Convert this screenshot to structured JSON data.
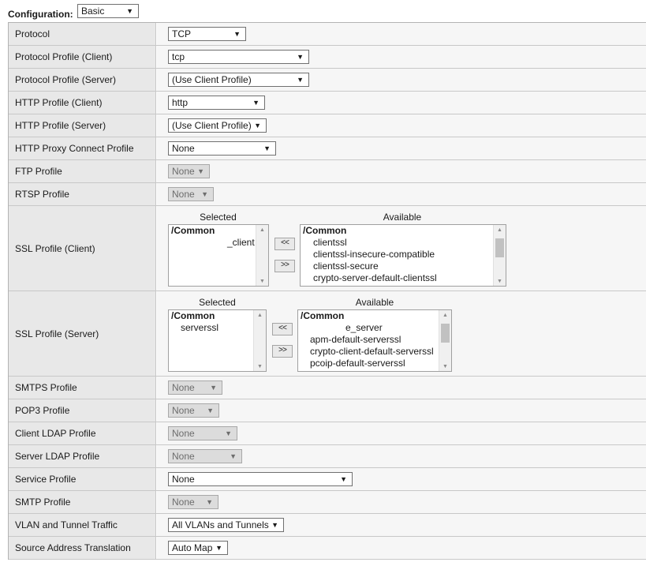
{
  "configuration": {
    "label": "Configuration:",
    "value": "Basic"
  },
  "rows": {
    "protocol": {
      "label": "Protocol",
      "value": "TCP"
    },
    "protocol_profile_client": {
      "label": "Protocol Profile (Client)",
      "value": "tcp"
    },
    "protocol_profile_server": {
      "label": "Protocol Profile (Server)",
      "value": "(Use Client Profile)"
    },
    "http_profile_client": {
      "label": "HTTP Profile (Client)",
      "value": "http"
    },
    "http_profile_server": {
      "label": "HTTP Profile (Server)",
      "value": "(Use Client Profile)"
    },
    "http_proxy_connect": {
      "label": "HTTP Proxy Connect Profile",
      "value": "None"
    },
    "ftp_profile": {
      "label": "FTP Profile",
      "value": "None"
    },
    "rtsp_profile": {
      "label": "RTSP Profile",
      "value": "None"
    },
    "ssl_client": {
      "label": "SSL Profile (Client)",
      "selected_caption": "Selected",
      "available_caption": "Available",
      "selected_items": [
        "/Common",
        "_client"
      ],
      "available_items": [
        "/Common",
        "clientssl",
        "clientssl-insecure-compatible",
        "clientssl-secure",
        "crypto-server-default-clientssl"
      ],
      "move_left": "<<",
      "move_right": ">>"
    },
    "ssl_server": {
      "label": "SSL Profile (Server)",
      "selected_caption": "Selected",
      "available_caption": "Available",
      "selected_items": [
        "/Common",
        "serverssl"
      ],
      "available_items": [
        "/Common",
        "e_server",
        "apm-default-serverssl",
        "crypto-client-default-serverssl",
        "pcoip-default-serverssl"
      ],
      "move_left": "<<",
      "move_right": ">>"
    },
    "smtps_profile": {
      "label": "SMTPS Profile",
      "value": "None"
    },
    "pop3_profile": {
      "label": "POP3 Profile",
      "value": "None"
    },
    "client_ldap": {
      "label": "Client LDAP Profile",
      "value": "None"
    },
    "server_ldap": {
      "label": "Server LDAP Profile",
      "value": "None"
    },
    "service_profile": {
      "label": "Service Profile",
      "value": "None"
    },
    "smtp_profile": {
      "label": "SMTP Profile",
      "value": "None"
    },
    "vlan_tunnel": {
      "label": "VLAN and Tunnel Traffic",
      "value": "All VLANs and Tunnels"
    },
    "source_address": {
      "label": "Source Address Translation",
      "value": "Auto Map"
    }
  },
  "icons": {
    "dropdown": "chevron-down-icon",
    "scroll_up": "scroll-up-icon",
    "scroll_down": "scroll-down-icon"
  }
}
